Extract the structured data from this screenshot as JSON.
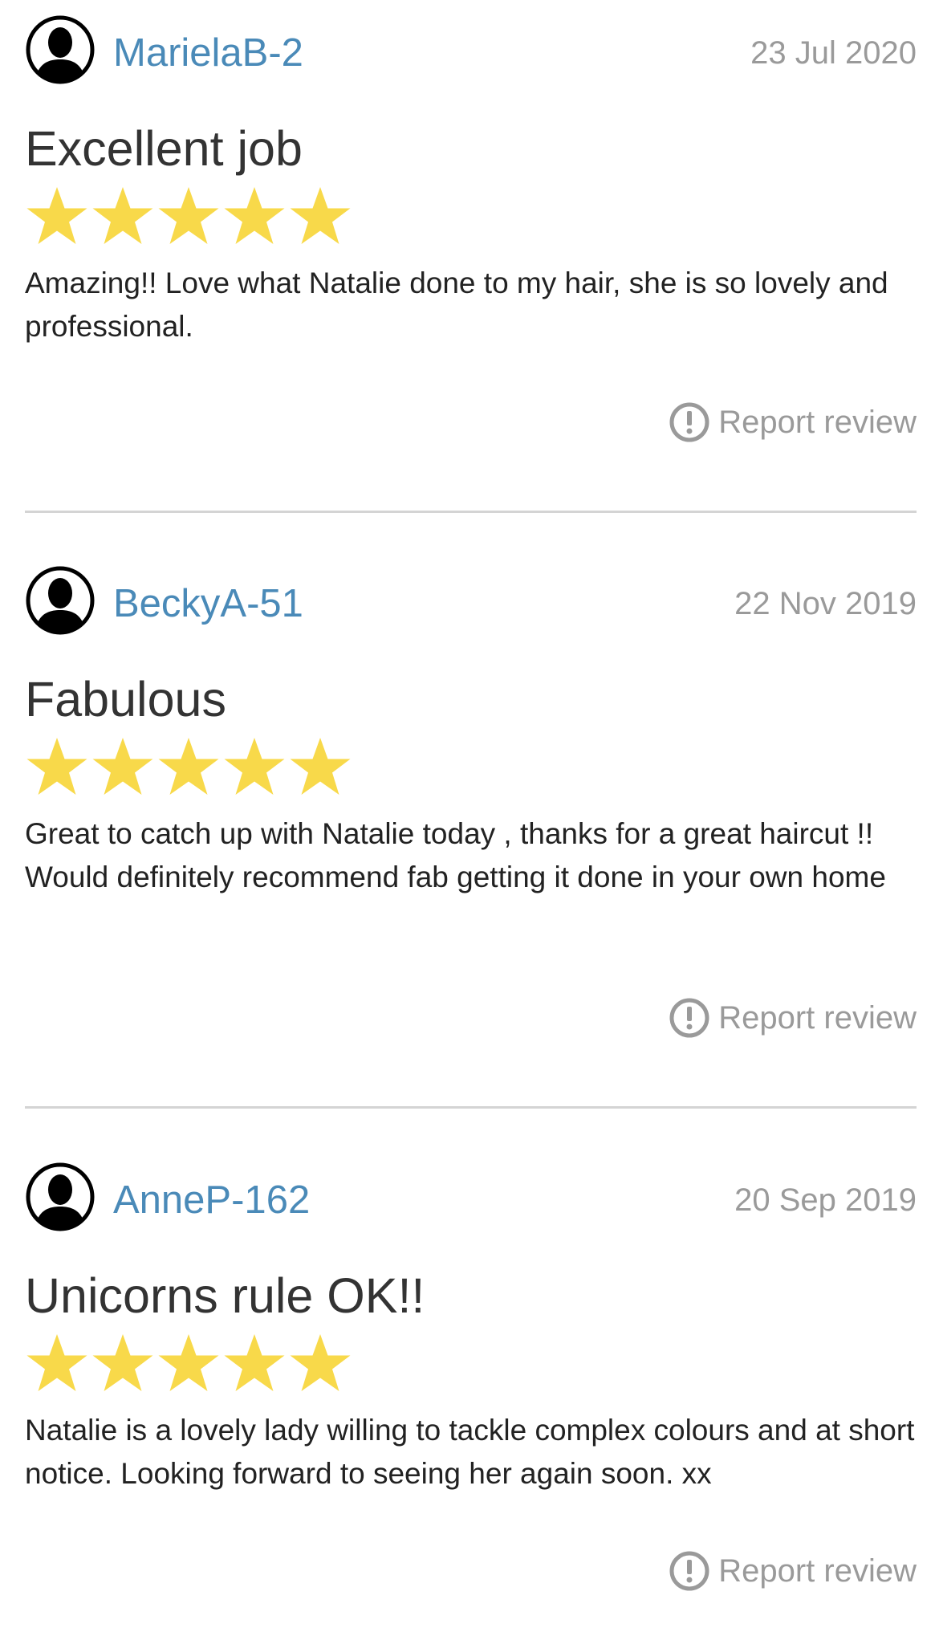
{
  "colors": {
    "username": "#4a8ab8",
    "date": "#9a9a9a",
    "title": "#333333",
    "body": "#222222",
    "star": "#f8d94a",
    "divider": "#d4d4d4"
  },
  "icons": {
    "avatar": "user-silhouette-icon",
    "star": "star-icon",
    "report": "exclamation-circle-icon"
  },
  "reviews": [
    {
      "username": "MarielaB-2",
      "date": "23 Jul 2020",
      "title": "Excellent job",
      "rating": 5,
      "rating_max": 5,
      "body": "Amazing!! Love what Natalie done to my hair, she is so lovely and professional.",
      "report_label": "Report review"
    },
    {
      "username": "BeckyA-51",
      "date": "22 Nov 2019",
      "title": "Fabulous",
      "rating": 5,
      "rating_max": 5,
      "body": "Great to catch up with Natalie today , thanks for a great haircut !! Would definitely recommend fab getting it done in your own home",
      "report_label": "Report review"
    },
    {
      "username": "AnneP-162",
      "date": "20 Sep 2019",
      "title": "Unicorns rule OK!!",
      "rating": 5,
      "rating_max": 5,
      "body": "Natalie is a lovely lady willing to tackle complex colours and at short notice. Looking forward to seeing her again soon. xx",
      "report_label": "Report review"
    }
  ]
}
